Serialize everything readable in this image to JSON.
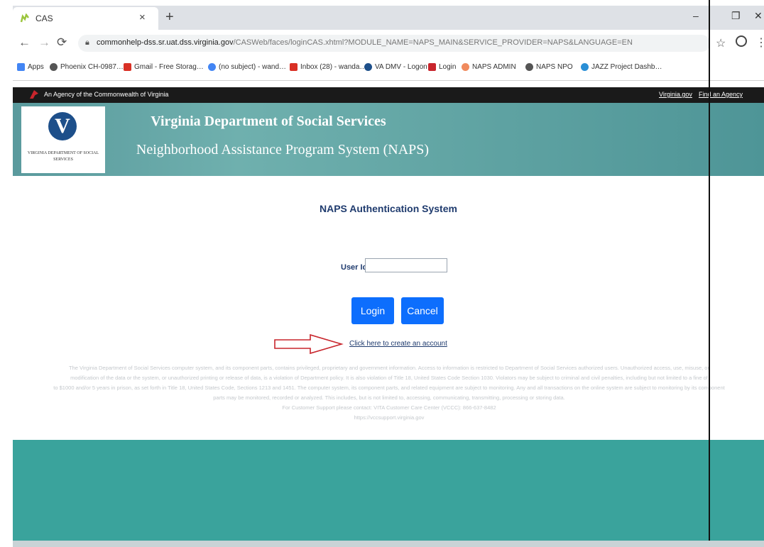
{
  "browser": {
    "tab_title": "CAS",
    "tab_close": "×",
    "new_tab": "+",
    "minimize": "–",
    "restore": "❐",
    "close_window": "✕",
    "url_main": "commonhelp-dss.sr.uat.dss.virginia.gov",
    "url_rest": "/CASWeb/faces/loginCAS.xhtml?MODULE_NAME=NAPS_MAIN&SERVICE_PROVIDER=NAPS&LANGUAGE=EN",
    "bookmarks": [
      {
        "label": "Apps",
        "icon": "apps-grid-icon",
        "color": "#4285f4"
      },
      {
        "label": "Phoenix CH-0987…!!",
        "icon": "globe-icon",
        "color": "#555555"
      },
      {
        "label": "Gmail - Free Storag…",
        "icon": "gmail-icon",
        "color": "#d93025"
      },
      {
        "label": "(no subject) - wand…",
        "icon": "google-icon",
        "color": "#4285f4"
      },
      {
        "label": "Inbox (28) - wanda…",
        "icon": "gmail-icon",
        "color": "#d93025"
      },
      {
        "label": "VA DMV - Logon",
        "icon": "dmv-icon",
        "color": "#1d4f8a"
      },
      {
        "label": "Login",
        "icon": "login-icon",
        "color": "#c8252c"
      },
      {
        "label": "NAPS ADMIN",
        "icon": "naps-icon",
        "color": "#f08a5d"
      },
      {
        "label": "NAPS NPO",
        "icon": "globe-icon",
        "color": "#555555"
      },
      {
        "label": "JAZZ Project Dashb…",
        "icon": "jazz-icon",
        "color": "#2a8fd6"
      }
    ]
  },
  "agency_bar": {
    "text": "An Agency of the Commonwealth of Virginia",
    "link1": "Virginia.gov",
    "link2": "Find an Agency"
  },
  "banner": {
    "logo_text": "VIRGINIA DEPARTMENT OF SOCIAL SERVICES",
    "title": "Virginia Department of Social Services",
    "subtitle": "Neighborhood Assistance Program System (NAPS)"
  },
  "login": {
    "heading": "NAPS Authentication System",
    "userid_label": "User Id:",
    "userid_value": "",
    "login_label": "Login",
    "cancel_label": "Cancel",
    "create_account": "Click here to create an account"
  },
  "disclaimer": {
    "line1": "The Virginia Department of Social Services computer system, and its component parts, contains privileged, proprietary and government information. Access to information is restricted to Department of Social Services authorized users. Unauthorized access, use, misuse, or",
    "line2": "modification of the data or the system, or unauthorized printing or release of data, is a violation of Department policy. It is also violation of Title 18, United States Code Section 1030. Violators may be subject to criminal and civil penalties, including but not limited to a fine of",
    "line3": "to $1000 and/or 5 years in prison, as set forth in Title 18, United States Code, Sections 1213 and 1451. The computer system, its component parts, and related equipment are subject to monitoring. Any and all transactions on the online system are subject to monitoring by its component",
    "line4": "parts may be monitored, recorded or analyzed. This includes, but is not limited to, accessing, communicating, transmitting, processing or storing data.",
    "line5": "For Customer Support please contact: VITA Customer Care Center (VCCC): 866-637-8482",
    "line6": "https://vccsupport.virginia.gov"
  }
}
